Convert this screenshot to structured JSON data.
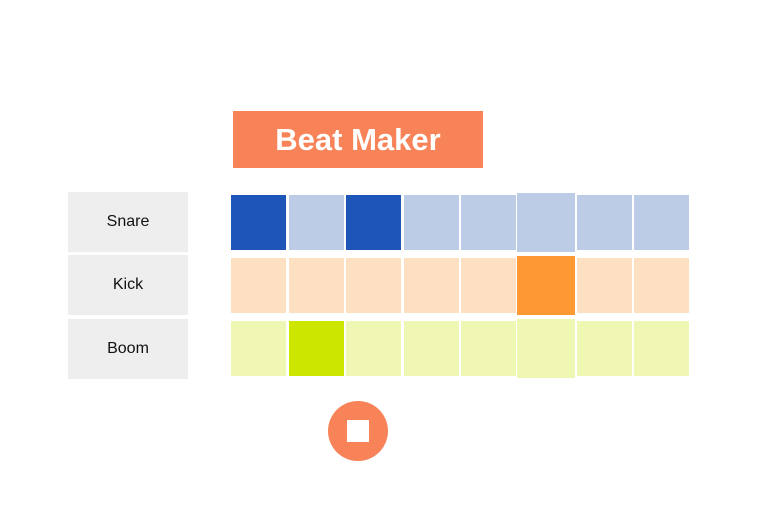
{
  "app": {
    "title": "Beat Maker",
    "accent_color": "#f88358"
  },
  "tracks": [
    {
      "label": "Snare",
      "active_color": "#1d56b8",
      "inactive_color": "#bccce7",
      "steps": [
        true,
        false,
        true,
        false,
        false,
        false,
        false,
        false
      ]
    },
    {
      "label": "Kick",
      "active_color": "#fe9833",
      "inactive_color": "#fde0c2",
      "steps": [
        false,
        false,
        false,
        false,
        false,
        true,
        false,
        false
      ]
    },
    {
      "label": "Boom",
      "active_color": "#cde600",
      "inactive_color": "#eff7b3",
      "steps": [
        false,
        true,
        false,
        false,
        false,
        false,
        false,
        false
      ]
    }
  ],
  "playhead_step": 6,
  "transport": {
    "icon": "stop-icon",
    "color": "#f88358"
  }
}
